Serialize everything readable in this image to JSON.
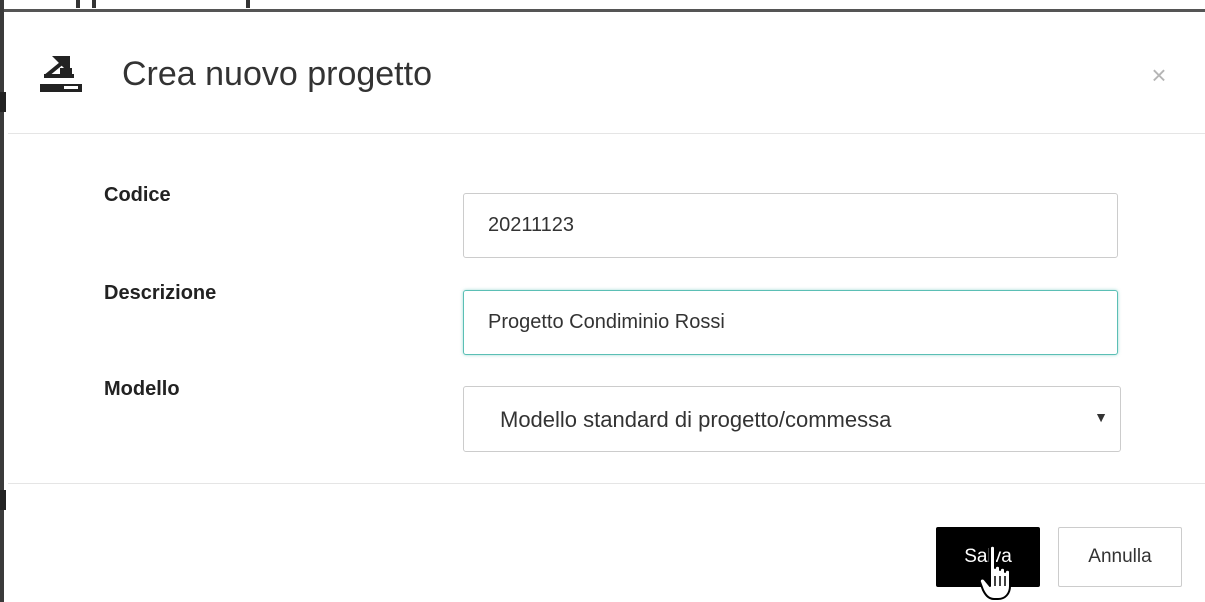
{
  "dialog": {
    "title": "Crea nuovo progetto",
    "close_label": "×",
    "header_icon": "import-project-icon"
  },
  "form": {
    "codice": {
      "label": "Codice",
      "value": "20211123"
    },
    "descrizione": {
      "label": "Descrizione",
      "value": "Progetto Condiminio Rossi"
    },
    "modello": {
      "label": "Modello",
      "selected": "Modello standard di progetto/commessa",
      "arrow": "▼"
    }
  },
  "footer": {
    "save_label": "Salva",
    "cancel_label": "Annulla"
  },
  "colors": {
    "focus_border": "#5bbfb5",
    "save_bg": "#000000",
    "title_text": "#333333"
  },
  "cursor": "hand-pointer-icon"
}
